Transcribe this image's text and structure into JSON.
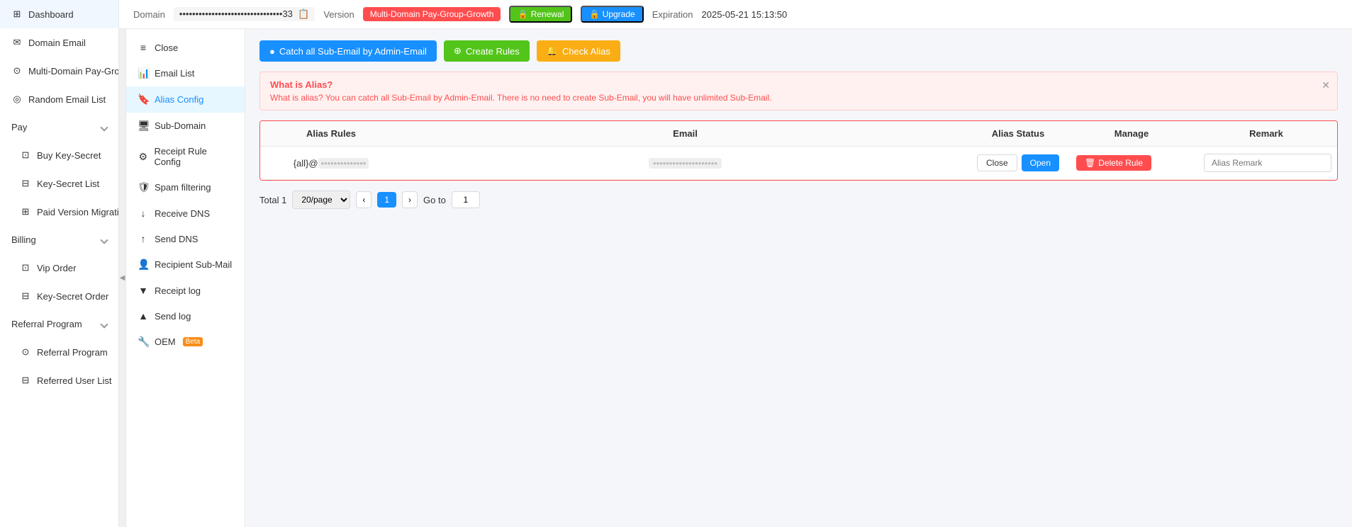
{
  "sidebar": {
    "items": [
      {
        "id": "dashboard",
        "label": "Dashboard",
        "icon": "⊞"
      },
      {
        "id": "domain-email",
        "label": "Domain Email",
        "icon": "✉"
      },
      {
        "id": "multi-domain",
        "label": "Multi-Domain Pay-Group",
        "icon": "⊙"
      },
      {
        "id": "random-email",
        "label": "Random Email List",
        "icon": "◎"
      },
      {
        "id": "pay",
        "label": "Pay",
        "icon": "",
        "expandable": true
      },
      {
        "id": "buy-key-secret",
        "label": "Buy Key-Secret",
        "icon": "⊡"
      },
      {
        "id": "key-secret-list",
        "label": "Key-Secret List",
        "icon": "⊟"
      },
      {
        "id": "paid-version",
        "label": "Paid Version Migration",
        "icon": "⊞"
      },
      {
        "id": "billing",
        "label": "Billing",
        "icon": "",
        "expandable": true
      },
      {
        "id": "vip-order",
        "label": "Vip Order",
        "icon": "⊡"
      },
      {
        "id": "key-secret-order",
        "label": "Key-Secret Order",
        "icon": "⊟"
      },
      {
        "id": "referral-program",
        "label": "Referral Program",
        "icon": "",
        "expandable": true
      },
      {
        "id": "referral-program-sub",
        "label": "Referral Program",
        "icon": "⊙"
      },
      {
        "id": "referred-user-list",
        "label": "Referred User List",
        "icon": "⊟"
      }
    ]
  },
  "header": {
    "domain_label": "Domain",
    "domain_value": "••••••••••••••••••••••••••••••••33",
    "version_label": "Version",
    "version_value": "Multi-Domain Pay-Group-Growth",
    "renewal_label": "🔒 Renewal",
    "upgrade_label": "🔒 Upgrade",
    "expiration_label": "Expiration",
    "expiration_value": "2025-05-21 15:13:50"
  },
  "inner_sidebar": {
    "items": [
      {
        "id": "close",
        "label": "Close",
        "icon": "≡"
      },
      {
        "id": "email-list",
        "label": "Email List",
        "icon": "📊"
      },
      {
        "id": "alias-config",
        "label": "Alias Config",
        "icon": "🔖",
        "active": true
      },
      {
        "id": "sub-domain",
        "label": "Sub-Domain",
        "icon": "🖥"
      },
      {
        "id": "receipt-rule",
        "label": "Receipt Rule Config",
        "icon": "⚙"
      },
      {
        "id": "spam-filtering",
        "label": "Spam filtering",
        "icon": "🛡"
      },
      {
        "id": "receive-dns",
        "label": "Receive DNS",
        "icon": "↓"
      },
      {
        "id": "send-dns",
        "label": "Send DNS",
        "icon": "↑"
      },
      {
        "id": "recipient-submail",
        "label": "Recipient Sub-Mail",
        "icon": "👤"
      },
      {
        "id": "receipt-log",
        "label": "Receipt log",
        "icon": "▼"
      },
      {
        "id": "send-log",
        "label": "Send log",
        "icon": "▲"
      },
      {
        "id": "oem",
        "label": "OEM",
        "icon": "🔧",
        "beta": true
      }
    ]
  },
  "action_buttons": {
    "catch_all": "Catch all Sub-Email by Admin-Email",
    "create_rules": "Create Rules",
    "check_alias": "Check Alias"
  },
  "info_box": {
    "title": "What is Alias?",
    "description": "What is alias? You can catch all Sub-Email by Admin-Email. There is no need to create Sub-Email, you will have unlimited Sub-Email."
  },
  "table": {
    "columns": [
      "Alias Rules",
      "Email",
      "Alias Status",
      "Manage",
      "Remark"
    ],
    "rows": [
      {
        "alias_rules": "{all}@••••••••••••••••",
        "email": "••••••••••••••••••••",
        "alias_status_close": "Close",
        "alias_status_open": "Open",
        "delete_label": "Delete Rule",
        "remark_placeholder": "Alias Remark"
      }
    ]
  },
  "pagination": {
    "total_label": "Total 1",
    "per_page": "20/page",
    "current_page": "1",
    "goto_label": "Go to",
    "goto_value": "1"
  }
}
